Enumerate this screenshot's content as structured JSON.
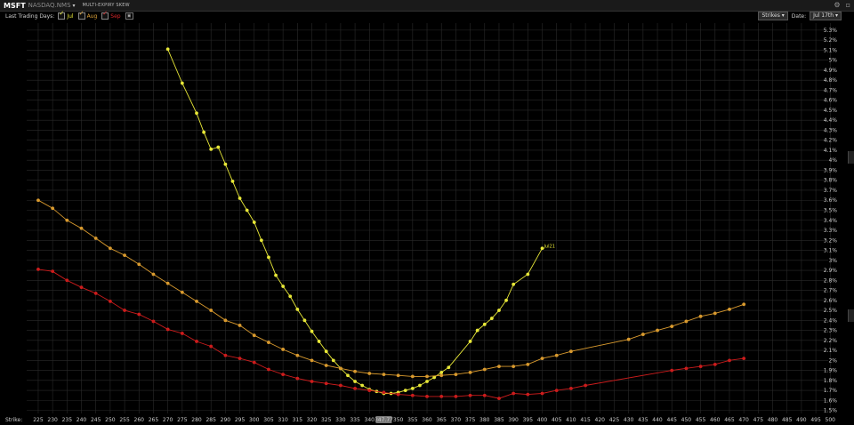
{
  "header": {
    "symbol": "MSFT",
    "exchange": "NASDAQ.NMS",
    "dropdown_glyph": "▾",
    "window_title": "MULTI-EXPIRY SKEW"
  },
  "icons": {
    "settings": "gear-icon",
    "close": "close-icon",
    "save": "save-icon"
  },
  "toolbar": {
    "last_trading_days_label": "Last Trading Days:",
    "expiries": [
      {
        "label": "Jul",
        "checked": true,
        "color": "#e8e838"
      },
      {
        "label": "Aug",
        "checked": true,
        "color": "#e0a43a"
      },
      {
        "label": "Sep",
        "checked": true,
        "color": "#d8262a"
      }
    ],
    "mode_select": "Strikes",
    "date_label": "Date:",
    "date_select": "Jul 17th"
  },
  "colors": {
    "jul": "#e8e838",
    "aug": "#d99a2e",
    "sep": "#cc1c1c",
    "grid": "#2a2a2a",
    "highlight": "#7a7a7a"
  },
  "chart_data": {
    "type": "line",
    "xlabel": "Strike:",
    "ylabel": "",
    "x_ticks": [
      225,
      230,
      235,
      240,
      245,
      250,
      255,
      260,
      265,
      270,
      275,
      280,
      285,
      290,
      295,
      300,
      305,
      310,
      315,
      320,
      325,
      330,
      335,
      340,
      345,
      350,
      355,
      360,
      365,
      370,
      375,
      380,
      385,
      390,
      395,
      400,
      405,
      410,
      415,
      420,
      425,
      430,
      435,
      440,
      445,
      450,
      455,
      460,
      465,
      470,
      475,
      480,
      485,
      490,
      495,
      500
    ],
    "x_tick_labels": [
      "225",
      "230",
      "235",
      "240",
      "245",
      "250",
      "255",
      "260",
      "265",
      "270",
      "275",
      "280",
      "285",
      "290",
      "295",
      "300",
      "305",
      "310",
      "315",
      "320",
      "325",
      "330",
      "335",
      "340",
      "347.77",
      "350",
      "355",
      "360",
      "365",
      "370",
      "375",
      "380",
      "385",
      "390",
      "395",
      "400",
      "405",
      "410",
      "415",
      "420",
      "425",
      "430",
      "435",
      "440",
      "445",
      "450",
      "455",
      "460",
      "465",
      "470",
      "475",
      "480",
      "485",
      "490",
      "495",
      "500"
    ],
    "highlight_x": 345,
    "xlim": [
      221,
      503
    ],
    "ylim": [
      1.47,
      5.37
    ],
    "y_ticks": [
      1.5,
      1.6,
      1.7,
      1.8,
      1.9,
      2.0,
      2.1,
      2.2,
      2.3,
      2.4,
      2.5,
      2.6,
      2.7,
      2.8,
      2.9,
      3.0,
      3.1,
      3.2,
      3.3,
      3.4,
      3.5,
      3.6,
      3.7,
      3.8,
      3.9,
      4.0,
      4.1,
      4.2,
      4.3,
      4.4,
      4.5,
      4.6,
      4.7,
      4.8,
      4.9,
      5.0,
      5.1,
      5.2,
      5.3
    ],
    "y_tick_labels": [
      "1.5%",
      "1.6%",
      "1.7%",
      "1.8%",
      "1.9%",
      "2%",
      "2.1%",
      "2.2%",
      "2.3%",
      "2.4%",
      "2.5%",
      "2.6%",
      "2.7%",
      "2.8%",
      "2.9%",
      "3%",
      "3.1%",
      "3.2%",
      "3.3%",
      "3.4%",
      "3.5%",
      "3.6%",
      "3.7%",
      "3.8%",
      "3.9%",
      "4%",
      "4.1%",
      "4.2%",
      "4.3%",
      "4.4%",
      "4.5%",
      "4.6%",
      "4.7%",
      "4.8%",
      "4.9%",
      "5%",
      "5.1%",
      "5.2%",
      "5.3%"
    ],
    "grid": true,
    "series": [
      {
        "name": "Jul21",
        "label": "Jul21",
        "points": [
          [
            270,
            5.11
          ],
          [
            275,
            4.77
          ],
          [
            280,
            4.47
          ],
          [
            282.5,
            4.28
          ],
          [
            285,
            4.11
          ],
          [
            287.5,
            4.13
          ],
          [
            290,
            3.96
          ],
          [
            292.5,
            3.79
          ],
          [
            295,
            3.62
          ],
          [
            297.5,
            3.5
          ],
          [
            300,
            3.38
          ],
          [
            302.5,
            3.2
          ],
          [
            305,
            3.03
          ],
          [
            307.5,
            2.85
          ],
          [
            310,
            2.74
          ],
          [
            312.5,
            2.64
          ],
          [
            315,
            2.51
          ],
          [
            317.5,
            2.4
          ],
          [
            320,
            2.29
          ],
          [
            322.5,
            2.19
          ],
          [
            325,
            2.09
          ],
          [
            327.5,
            2.0
          ],
          [
            330,
            1.92
          ],
          [
            332.5,
            1.85
          ],
          [
            335,
            1.79
          ],
          [
            337.5,
            1.75
          ],
          [
            340,
            1.71
          ],
          [
            342.5,
            1.69
          ],
          [
            345,
            1.67
          ],
          [
            347.5,
            1.67
          ],
          [
            350,
            1.68
          ],
          [
            352.5,
            1.7
          ],
          [
            355,
            1.72
          ],
          [
            357.5,
            1.75
          ],
          [
            360,
            1.79
          ],
          [
            362.5,
            1.83
          ],
          [
            365,
            1.88
          ],
          [
            367.5,
            1.93
          ],
          [
            375,
            2.19
          ],
          [
            377.5,
            2.3
          ],
          [
            380,
            2.36
          ],
          [
            382.5,
            2.42
          ],
          [
            385,
            2.5
          ],
          [
            387.5,
            2.6
          ],
          [
            390,
            2.76
          ],
          [
            395,
            2.86
          ],
          [
            400,
            3.12
          ]
        ]
      },
      {
        "name": "Aug",
        "points": [
          [
            225,
            3.6
          ],
          [
            230,
            3.52
          ],
          [
            235,
            3.4
          ],
          [
            240,
            3.32
          ],
          [
            245,
            3.22
          ],
          [
            250,
            3.12
          ],
          [
            255,
            3.05
          ],
          [
            260,
            2.96
          ],
          [
            265,
            2.86
          ],
          [
            270,
            2.77
          ],
          [
            275,
            2.68
          ],
          [
            280,
            2.59
          ],
          [
            285,
            2.5
          ],
          [
            290,
            2.4
          ],
          [
            295,
            2.35
          ],
          [
            300,
            2.25
          ],
          [
            305,
            2.18
          ],
          [
            310,
            2.11
          ],
          [
            315,
            2.05
          ],
          [
            320,
            2.0
          ],
          [
            325,
            1.95
          ],
          [
            330,
            1.92
          ],
          [
            335,
            1.89
          ],
          [
            340,
            1.87
          ],
          [
            345,
            1.86
          ],
          [
            350,
            1.85
          ],
          [
            355,
            1.84
          ],
          [
            360,
            1.84
          ],
          [
            365,
            1.85
          ],
          [
            370,
            1.86
          ],
          [
            375,
            1.88
          ],
          [
            380,
            1.91
          ],
          [
            385,
            1.94
          ],
          [
            390,
            1.94
          ],
          [
            395,
            1.96
          ],
          [
            400,
            2.02
          ],
          [
            405,
            2.05
          ],
          [
            410,
            2.09
          ],
          [
            430,
            2.21
          ],
          [
            435,
            2.26
          ],
          [
            440,
            2.3
          ],
          [
            445,
            2.34
          ],
          [
            450,
            2.39
          ],
          [
            455,
            2.44
          ],
          [
            460,
            2.47
          ],
          [
            465,
            2.51
          ],
          [
            470,
            2.56
          ]
        ]
      },
      {
        "name": "Sep",
        "points": [
          [
            225,
            2.91
          ],
          [
            230,
            2.89
          ],
          [
            235,
            2.8
          ],
          [
            240,
            2.73
          ],
          [
            245,
            2.67
          ],
          [
            250,
            2.59
          ],
          [
            255,
            2.5
          ],
          [
            260,
            2.46
          ],
          [
            265,
            2.39
          ],
          [
            270,
            2.31
          ],
          [
            275,
            2.27
          ],
          [
            280,
            2.19
          ],
          [
            285,
            2.14
          ],
          [
            290,
            2.05
          ],
          [
            295,
            2.02
          ],
          [
            300,
            1.98
          ],
          [
            305,
            1.91
          ],
          [
            310,
            1.86
          ],
          [
            315,
            1.82
          ],
          [
            320,
            1.79
          ],
          [
            325,
            1.77
          ],
          [
            330,
            1.75
          ],
          [
            335,
            1.72
          ],
          [
            340,
            1.7
          ],
          [
            345,
            1.68
          ],
          [
            350,
            1.66
          ],
          [
            355,
            1.65
          ],
          [
            360,
            1.64
          ],
          [
            365,
            1.64
          ],
          [
            370,
            1.64
          ],
          [
            375,
            1.65
          ],
          [
            380,
            1.65
          ],
          [
            385,
            1.62
          ],
          [
            390,
            1.67
          ],
          [
            395,
            1.66
          ],
          [
            400,
            1.67
          ],
          [
            405,
            1.7
          ],
          [
            410,
            1.72
          ],
          [
            415,
            1.75
          ],
          [
            445,
            1.9
          ],
          [
            450,
            1.92
          ],
          [
            455,
            1.94
          ],
          [
            460,
            1.96
          ],
          [
            465,
            2.0
          ],
          [
            470,
            2.02
          ]
        ]
      }
    ]
  }
}
